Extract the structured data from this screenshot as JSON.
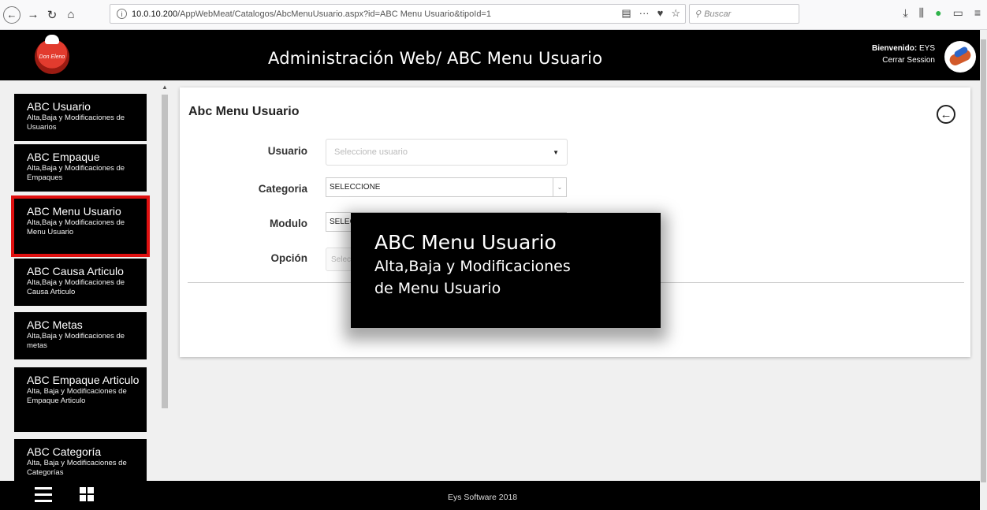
{
  "browser": {
    "url_prefix": "10.0.10.200",
    "url_path": "/AppWebMeat/Catalogos/AbcMenuUsuario.aspx?id=ABC Menu Usuario&tipoId=1",
    "search_placeholder": "Buscar"
  },
  "header": {
    "title": "Administración Web/ ABC Menu Usuario",
    "welcome_label": "Bienvenido:",
    "welcome_user": "EYS",
    "logout": "Cerrar Session",
    "logo_text": "Don Eleno"
  },
  "sidebar": {
    "items": [
      {
        "title": "ABC Usuario",
        "subtitle": "Alta,Baja y Modificaciones de Usuarios"
      },
      {
        "title": "ABC Empaque",
        "subtitle": "Alta,Baja y Modificaciones de Empaques"
      },
      {
        "title": "ABC Menu Usuario",
        "subtitle": "Alta,Baja y Modificaciones de Menu Usuario",
        "active": true
      },
      {
        "title": "ABC Causa Articulo",
        "subtitle": "Alta,Baja y Modificaciones de Causa Articulo"
      },
      {
        "title": "ABC Metas",
        "subtitle": "Alta,Baja y Modificaciones de metas"
      },
      {
        "title": "ABC Empaque Articulo",
        "subtitle": "Alta, Baja y Modificaciones de Empaque Articulo"
      },
      {
        "title": "ABC Categoría",
        "subtitle": "Alta, Baja y Modificaciones de Categorías"
      }
    ]
  },
  "form": {
    "title": "Abc Menu Usuario",
    "usuario_label": "Usuario",
    "usuario_placeholder": "Seleccione usuario",
    "categoria_label": "Categoria",
    "categoria_value": "SELECCIONE",
    "modulo_label": "Modulo",
    "modulo_value": "SELECCIONE",
    "opcion_label": "Opción",
    "opcion_placeholder": "Seleccione"
  },
  "tooltip": {
    "title": "ABC Menu Usuario",
    "line1": "Alta,Baja y Modificaciones",
    "line2": "de Menu Usuario"
  },
  "footer": {
    "text": "Eys Software 2018"
  },
  "colors": {
    "header_bg": "#000000",
    "active_outline": "#e01010",
    "page_bg": "#f0f0f0"
  }
}
